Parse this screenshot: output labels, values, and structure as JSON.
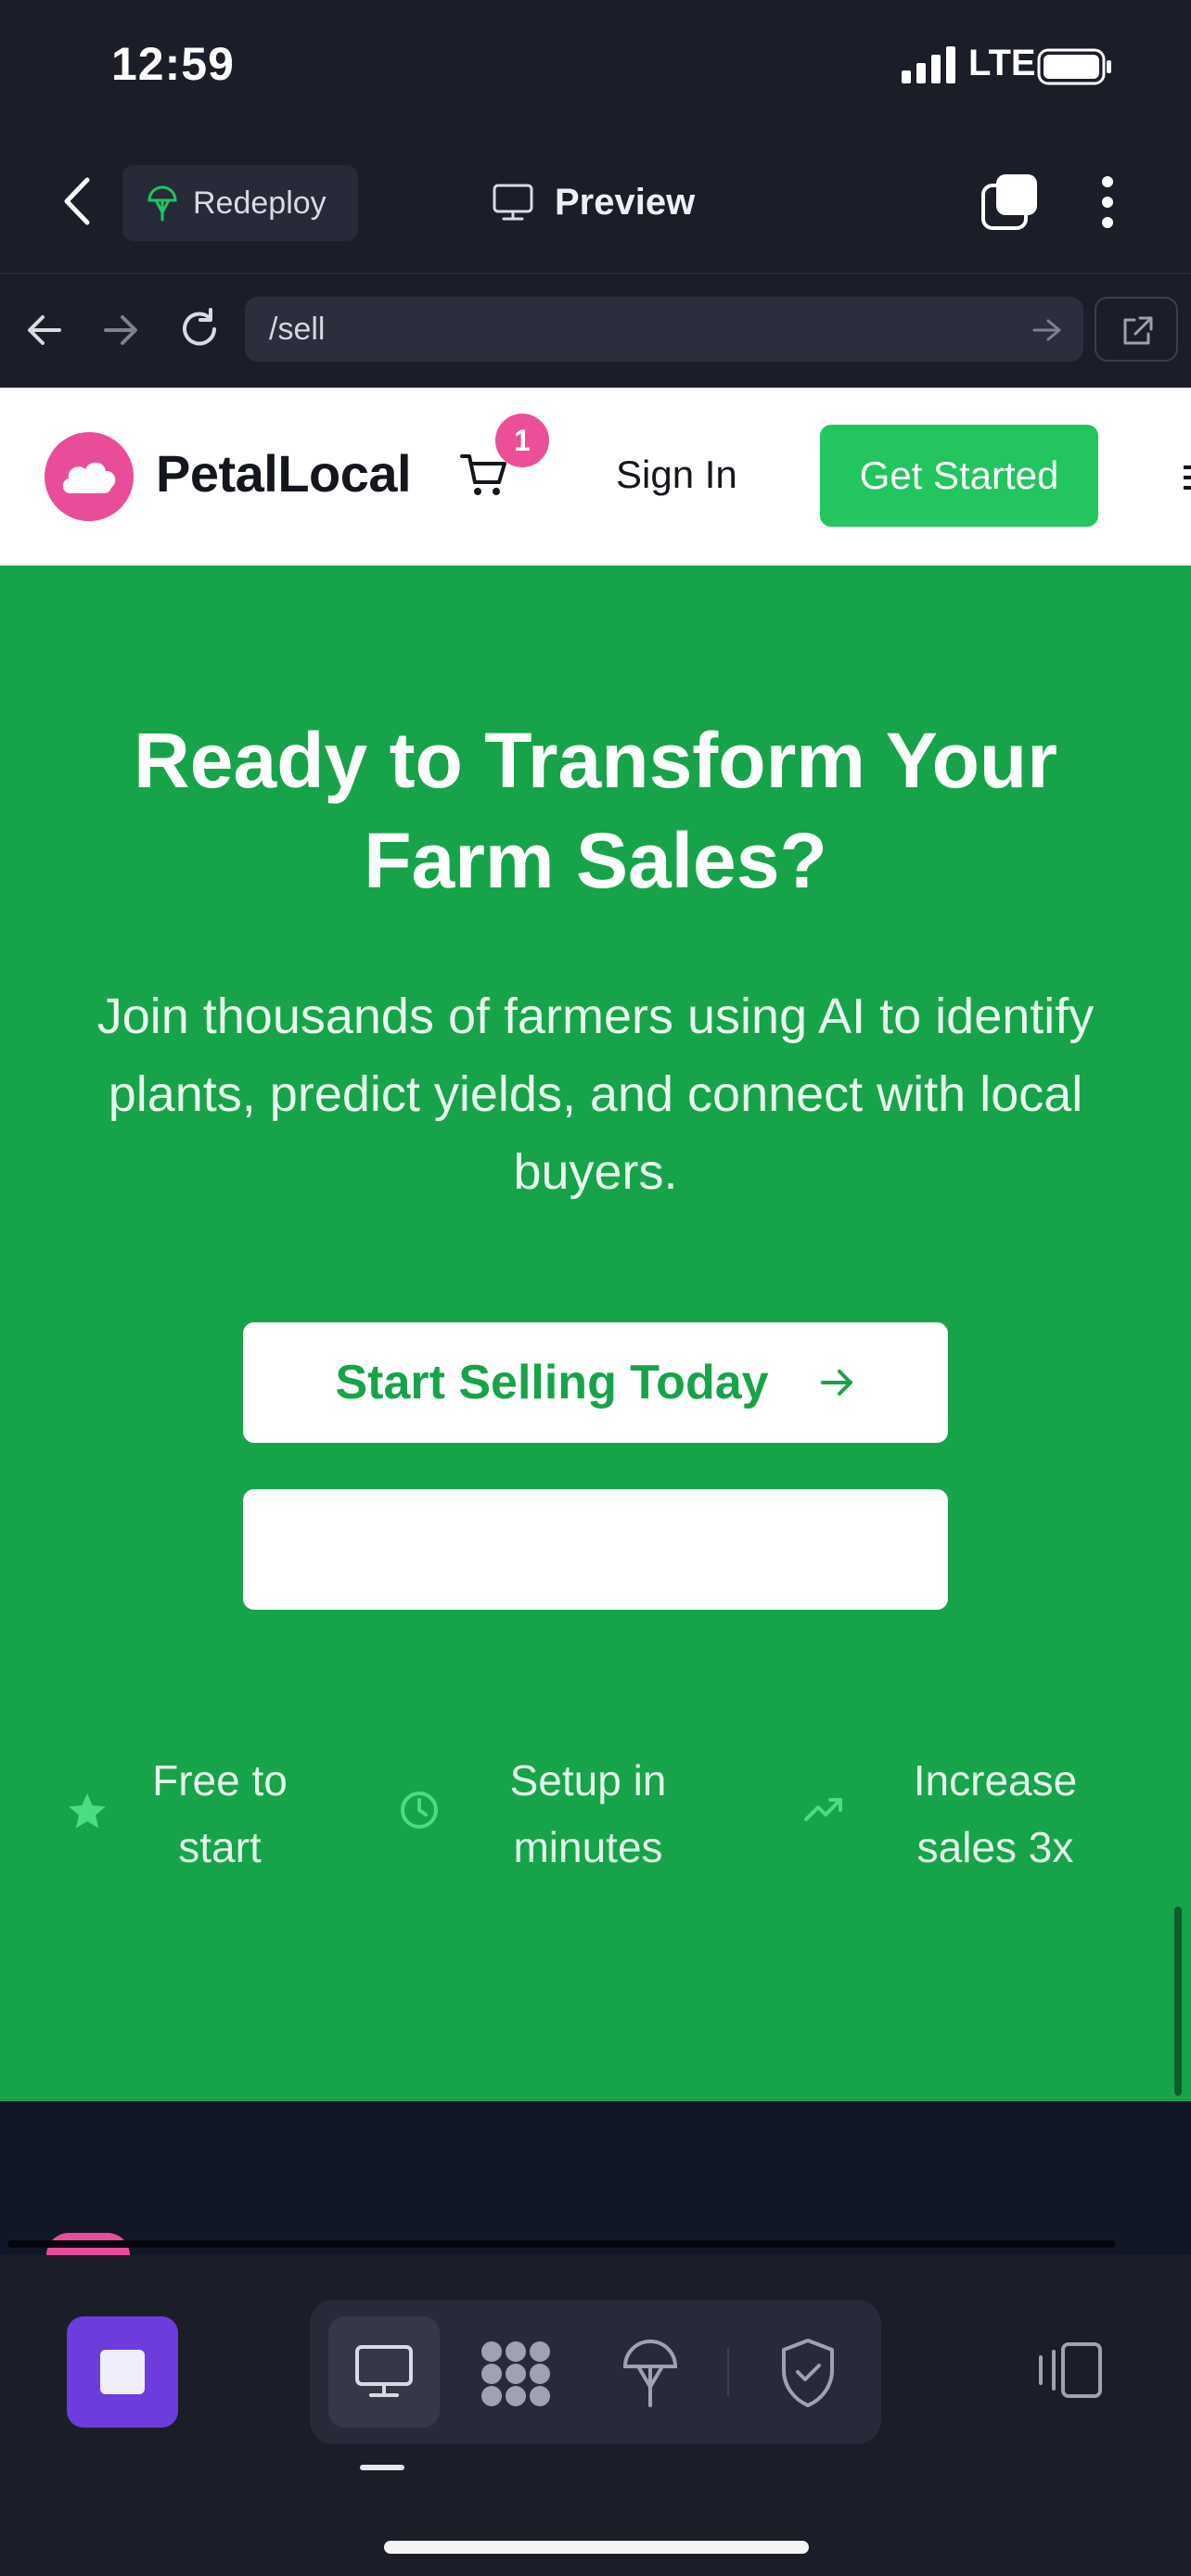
{
  "status_bar": {
    "time": "12:59",
    "network": "LTE"
  },
  "app_header": {
    "redeploy_label": "Redeploy",
    "preview_label": "Preview"
  },
  "browser": {
    "url": "/sell"
  },
  "site_nav": {
    "brand": "PetalLocal",
    "cart_count": "1",
    "sign_in": "Sign In",
    "get_started": "Get Started"
  },
  "hero": {
    "title": "Ready to Transform Your Farm Sales?",
    "subtitle": "Join thousands of farmers using AI to identify plants, predict yields, and connect with local buyers.",
    "primary_cta": "Start Selling Today",
    "secondary_cta": "",
    "features": [
      {
        "icon": "star-icon",
        "text": "Free to start"
      },
      {
        "icon": "clock-icon",
        "text": "Setup in minutes"
      },
      {
        "icon": "trending-up-icon",
        "text": "Increase sales 3x"
      }
    ]
  },
  "colors": {
    "hero_green": "#17a34a",
    "button_green": "#22c55e",
    "brand_pink": "#e94d9a",
    "stop_purple": "#6c3cdc"
  }
}
